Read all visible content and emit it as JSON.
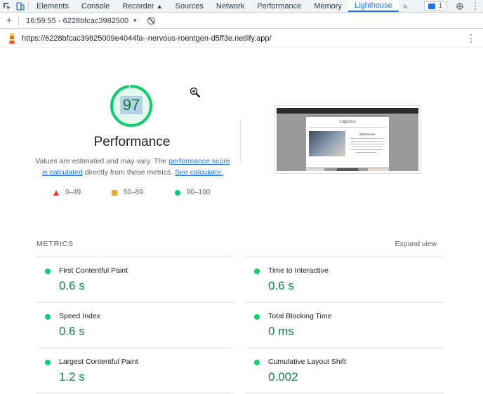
{
  "devtools": {
    "tabs": [
      {
        "label": "Elements"
      },
      {
        "label": "Console"
      },
      {
        "label": "Recorder"
      },
      {
        "label": "Sources"
      },
      {
        "label": "Network"
      },
      {
        "label": "Performance"
      },
      {
        "label": "Memory"
      },
      {
        "label": "Lighthouse"
      }
    ],
    "more_label": "»",
    "issues_count": "1"
  },
  "report_bar": {
    "report_label": "16:59:55 - 6228bfcac3982500"
  },
  "url_bar": {
    "url": "https://6228bfcac39825009e4044fa--nervous-roentgen-d5ff3e.netlify.app/"
  },
  "summary": {
    "score": "97",
    "score_fraction": 0.97,
    "title": "Performance",
    "desc_prefix": "Values are estimated and may vary. The ",
    "desc_link1": "performance score is calculated",
    "desc_mid": " directly from these metrics. ",
    "desc_link2": "See calculator."
  },
  "legend": [
    {
      "label": "0–49",
      "shape": "triangle",
      "color": "#e53935"
    },
    {
      "label": "50–89",
      "shape": "square",
      "color": "#f9a825"
    },
    {
      "label": "90–100",
      "shape": "circle",
      "color": "#0cce6b"
    }
  ],
  "thumbnail": {
    "card_title": "Logistics",
    "card_heading": "Warehouse"
  },
  "metrics": {
    "heading": "METRICS",
    "expand_label": "Expand view",
    "items": [
      {
        "name": "First Contentful Paint",
        "value": "0.6 s"
      },
      {
        "name": "Time to Interactive",
        "value": "0.6 s"
      },
      {
        "name": "Speed Index",
        "value": "0.6 s"
      },
      {
        "name": "Total Blocking Time",
        "value": "0 ms"
      },
      {
        "name": "Largest Contentful Paint",
        "value": "1.2 s"
      },
      {
        "name": "Cumulative Layout Shift",
        "value": "0.002"
      }
    ]
  },
  "colors": {
    "pass_green": "#0cce6b",
    "pass_text": "#0b8a3d",
    "accent_blue": "#1a73e8"
  }
}
